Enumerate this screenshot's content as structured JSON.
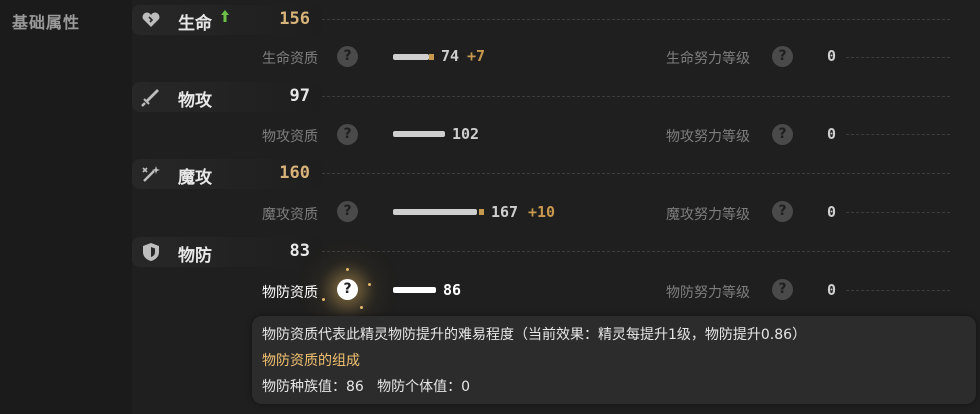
{
  "section": {
    "title": "基础属性"
  },
  "stats": [
    {
      "name": "生命",
      "value": "156",
      "value_color": "gold",
      "icon": "heart-icon",
      "trend": "up",
      "aptitude": {
        "label": "生命资质",
        "value": "74",
        "bonus": "+7",
        "bar_fraction": 0.3
      },
      "effort": {
        "label": "生命努力等级",
        "value": "0"
      }
    },
    {
      "name": "物攻",
      "value": "97",
      "value_color": "white",
      "icon": "sword-icon",
      "aptitude": {
        "label": "物攻资质",
        "value": "102",
        "bar_fraction": 0.43
      },
      "effort": {
        "label": "物攻努力等级",
        "value": "0"
      }
    },
    {
      "name": "魔攻",
      "value": "160",
      "value_color": "gold",
      "icon": "magic-wand-icon",
      "aptitude": {
        "label": "魔攻资质",
        "value": "167",
        "bonus": "+10",
        "bar_fraction": 0.7
      },
      "effort": {
        "label": "魔攻努力等级",
        "value": "0"
      }
    },
    {
      "name": "物防",
      "value": "83",
      "value_color": "white",
      "icon": "shield-icon",
      "aptitude": {
        "label": "物防资质",
        "value": "86",
        "bar_fraction": 0.36,
        "active": true
      },
      "effort": {
        "label": "物防努力等级",
        "value": "0"
      }
    }
  ],
  "help_glyph": "?",
  "tooltip": {
    "description": "物防资质代表此精灵物防提升的难易程度（当前效果：精灵每提升1级，物防提升0.86）",
    "heading": "物防资质的组成",
    "detail": "物防种族值：86   物防个体值：0"
  },
  "colors": {
    "gold": "#d7b37a",
    "bonus": "#c7994e",
    "heading": "#f0c070",
    "up_arrow": "#6cc04a"
  }
}
